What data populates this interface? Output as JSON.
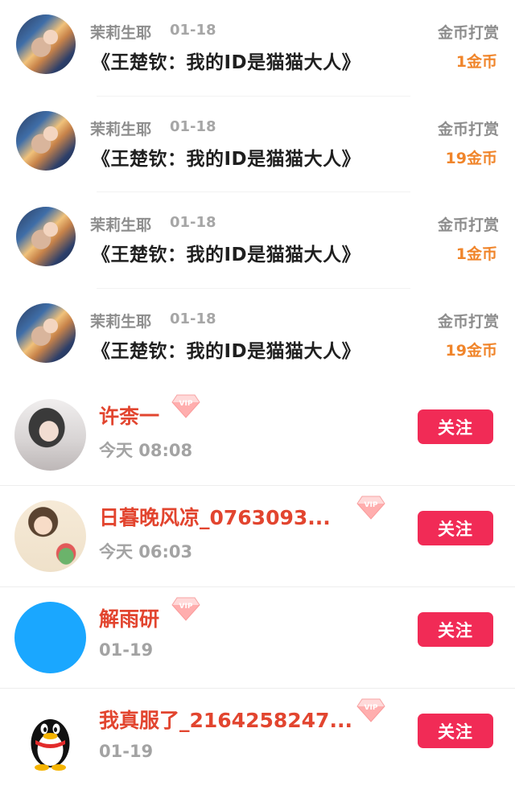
{
  "tips": [
    {
      "sender": "茉莉生耶",
      "date": "01-18",
      "book": "《王楚钦：我的ID是猫猫大人》",
      "label": "金币打赏",
      "amount": "1金币"
    },
    {
      "sender": "茉莉生耶",
      "date": "01-18",
      "book": "《王楚钦：我的ID是猫猫大人》",
      "label": "金币打赏",
      "amount": "19金币"
    },
    {
      "sender": "茉莉生耶",
      "date": "01-18",
      "book": "《王楚钦：我的ID是猫猫大人》",
      "label": "金币打赏",
      "amount": "1金币"
    },
    {
      "sender": "茉莉生耶",
      "date": "01-18",
      "book": "《王楚钦：我的ID是猫猫大人》",
      "label": "金币打赏",
      "amount": "19金币"
    }
  ],
  "fans": [
    {
      "name": "许柰一",
      "time": "今天 08:08",
      "follow_label": "关注",
      "avatar": "photo-girl"
    },
    {
      "name": "日暮晚风凉_0763093...",
      "time": "今天 06:03",
      "follow_label": "关注",
      "avatar": "cartoon-girl"
    },
    {
      "name": "解雨研",
      "time": "01-19",
      "follow_label": "关注",
      "avatar": "blue-circle"
    },
    {
      "name": "我真服了_2164258247...",
      "time": "01-19",
      "follow_label": "关注",
      "avatar": "qq-penguin"
    }
  ],
  "vip_badge_text": "VIP",
  "colors": {
    "accent_red": "#f12b56",
    "name_red": "#e2452f",
    "coin_orange": "#f0852b"
  }
}
